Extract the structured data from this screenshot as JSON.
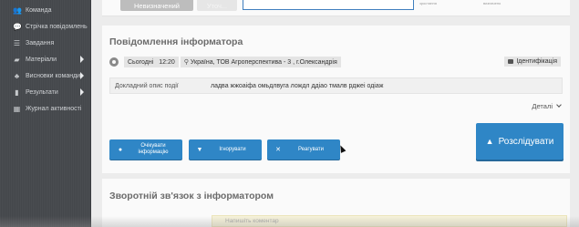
{
  "sidebar": {
    "items": [
      {
        "label": "Команда",
        "icon": "users-icon",
        "glyph": "👥",
        "has_arrow": false
      },
      {
        "label": "Стрічка повідомлень",
        "icon": "comments-icon",
        "glyph": "💬",
        "has_arrow": false
      },
      {
        "label": "Завдання",
        "icon": "tasks-icon",
        "glyph": "☰",
        "has_arrow": false
      },
      {
        "label": "Матеріали",
        "icon": "folder-icon",
        "glyph": "▰",
        "has_arrow": true
      },
      {
        "label": "Висновки команди",
        "icon": "hierarchy-icon",
        "glyph": "♣",
        "has_arrow": true
      },
      {
        "label": "Результати",
        "icon": "chart-icon",
        "glyph": "▮",
        "has_arrow": true
      },
      {
        "label": "Журнал активності",
        "icon": "calendar-icon",
        "glyph": "▦",
        "has_arrow": false
      }
    ]
  },
  "top": {
    "unassigned_label": "Невизначений",
    "ghost_label": "Уточ...",
    "mini_label_1": "зростання",
    "mini_label_2": "визначено"
  },
  "report": {
    "title": "Повідомлення інформатора",
    "date": "Сьогодні",
    "time": "12:20",
    "location": "Україна, ТОВ Агроперспектива - 3 , г.Олександрія",
    "identify_label": "Ідентифікація",
    "desc_label": "Докладний опис події",
    "desc_text": "ладва жжоаіфа омьдлвуга лождл ддіао тмалв рджеі одіаж",
    "details_label": "Деталі",
    "buttons": {
      "wait_line1": "Очікувати",
      "wait_line2": "інформацію",
      "ignore": "Ігнорувати",
      "react": "Реагувати",
      "investigate": "Розслідувати"
    }
  },
  "feedback": {
    "title": "Зворотній зв'язок з інформатором",
    "comment_placeholder": "Напишіть коментар"
  },
  "colors": {
    "sidebar_bg": "#47494d",
    "primary_button": "#2f86c6",
    "card_bg": "#fafafa"
  }
}
